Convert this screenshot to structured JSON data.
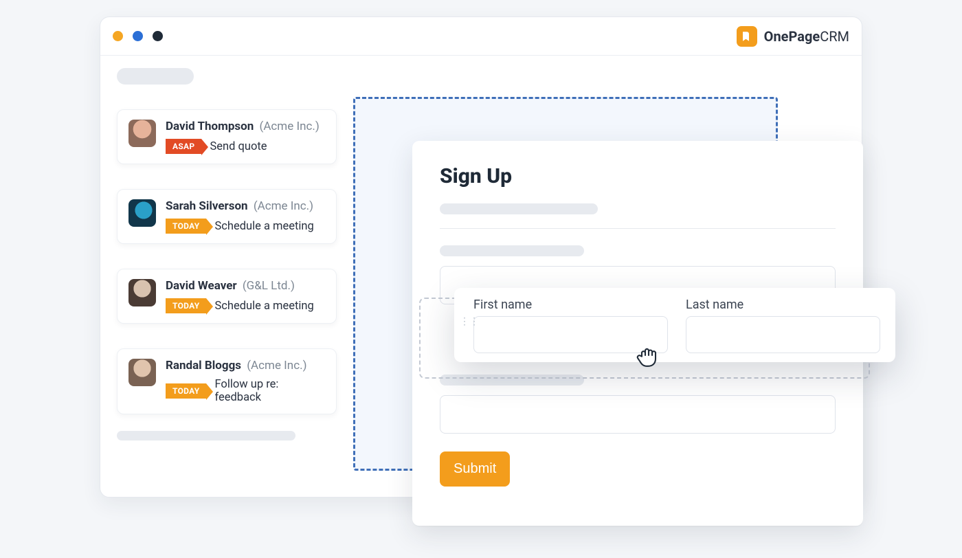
{
  "brand": {
    "name_bold": "OnePage",
    "name_light": "CRM"
  },
  "contacts": [
    {
      "name": "David Thompson",
      "company": "(Acme Inc.)",
      "flag_label": "ASAP",
      "flag_class": "red",
      "task": "Send quote"
    },
    {
      "name": "Sarah Silverson",
      "company": "(Acme Inc.)",
      "flag_label": "TODAY",
      "flag_class": "orange",
      "task": "Schedule a meeting"
    },
    {
      "name": "David Weaver",
      "company": "(G&L Ltd.)",
      "flag_label": "TODAY",
      "flag_class": "orange",
      "task": "Schedule a meeting"
    },
    {
      "name": "Randal Bloggs",
      "company": "(Acme Inc.)",
      "flag_label": "TODAY",
      "flag_class": "orange",
      "task": "Follow up re: feedback"
    }
  ],
  "signup": {
    "title": "Sign Up",
    "field_a_label": "First name",
    "field_b_label": "Last name",
    "submit_label": "Submit"
  }
}
